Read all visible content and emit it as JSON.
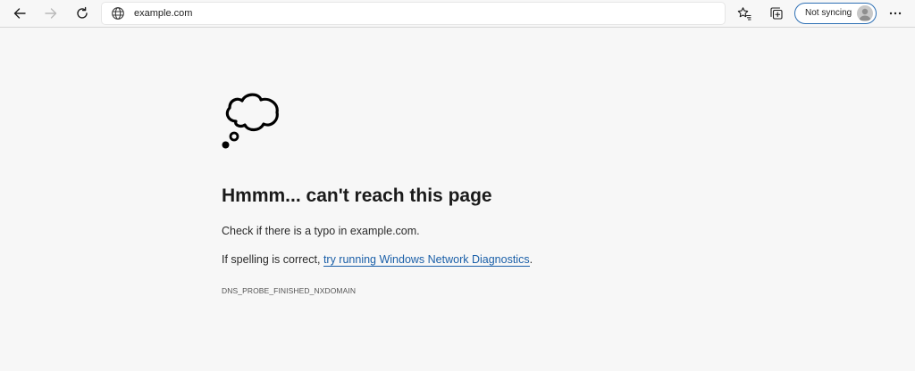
{
  "browser": {
    "url": "example.com",
    "profile_label": "Not syncing",
    "accent_color": "#2d6fb4"
  },
  "icons": {
    "back": "arrow-left",
    "forward": "arrow-right",
    "refresh": "circular-arrow",
    "site_info": "globe",
    "favorites": "star-with-lines",
    "collections": "collections-squares",
    "profile": "person-silhouette",
    "menu": "three-dots",
    "error": "thought-bubble"
  },
  "error_page": {
    "heading": "Hmmm... can't reach this page",
    "typo_message": "Check if there is a typo in example.com.",
    "spelling_prefix": "If spelling is correct, ",
    "diagnostics_link": "try running Windows Network Diagnostics",
    "spelling_suffix": ".",
    "error_code": "DNS_PROBE_FINISHED_NXDOMAIN",
    "link_color": "#1a5fa8"
  }
}
